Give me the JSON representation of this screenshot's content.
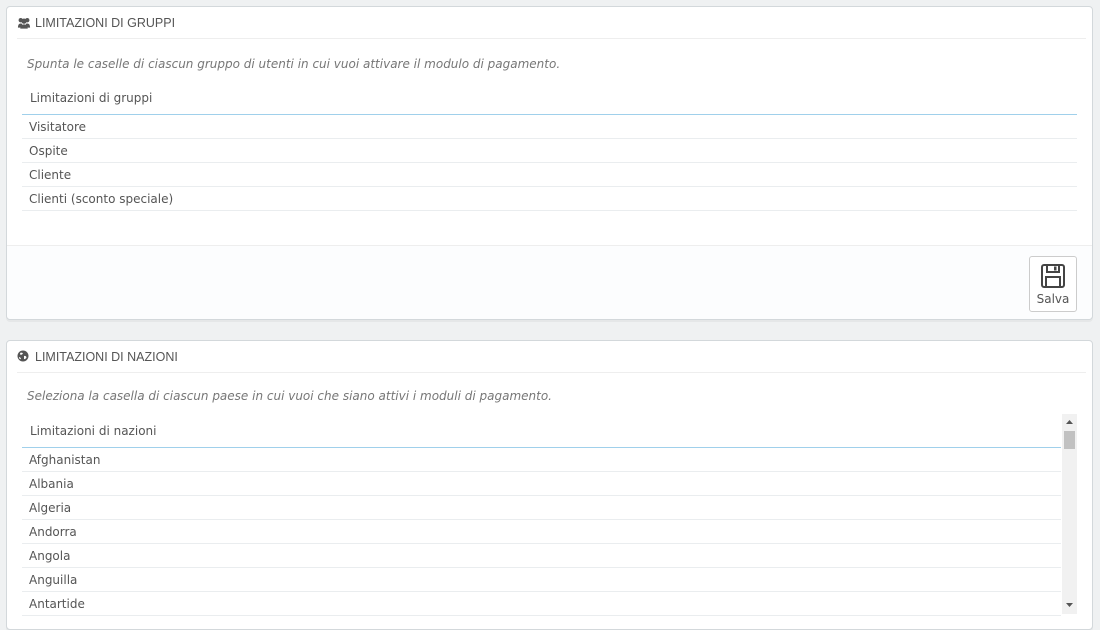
{
  "groups_panel": {
    "title": "LIMITAZIONI DI GRUPPI",
    "icon": "users-icon",
    "description": "Spunta le caselle di ciascun gruppo di utenti in cui vuoi attivare il modulo di pagamento.",
    "column_header": "Limitazioni di gruppi",
    "rows": [
      "Visitatore",
      "Ospite",
      "Cliente",
      "Clienti (sconto speciale)"
    ],
    "save_label": "Salva"
  },
  "countries_panel": {
    "title": "LIMITAZIONI DI NAZIONI",
    "icon": "globe-icon",
    "description": "Seleziona la casella di ciascun paese in cui vuoi che siano attivi i moduli di pagamento.",
    "column_header": "Limitazioni di nazioni",
    "rows": [
      "Afghanistan",
      "Albania",
      "Algeria",
      "Andorra",
      "Angola",
      "Anguilla",
      "Antartide"
    ]
  },
  "colors": {
    "header_border": "#a0d0eb",
    "background": "#eff1f2"
  }
}
